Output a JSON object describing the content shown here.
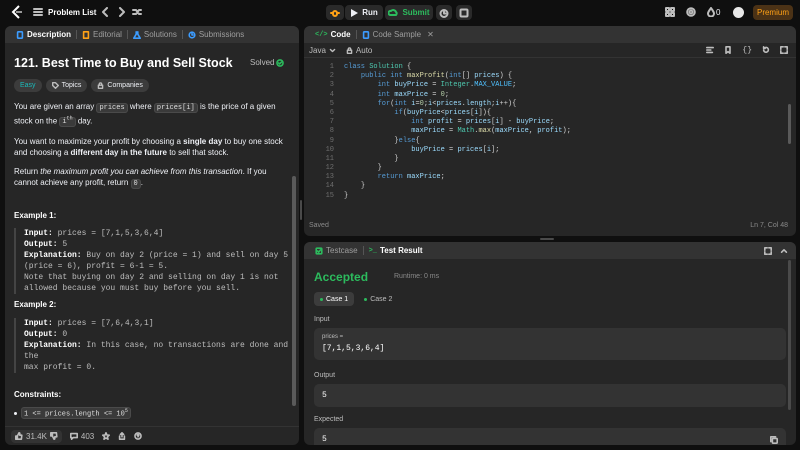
{
  "topbar": {
    "problem_list": "Problem List",
    "run": "Run",
    "submit": "Submit",
    "streak": "0",
    "premium": "Premium"
  },
  "colors": {
    "accent_orange": "#ffa116",
    "green": "#2cbb5d",
    "bg": "#0f0f0f",
    "panel": "#262626"
  },
  "left": {
    "tabs": [
      "Description",
      "Editorial",
      "Solutions",
      "Submissions"
    ],
    "title": "121. Best Time to Buy and Sell Stock",
    "solved": "Solved",
    "tags": [
      "Easy",
      "Topics",
      "Companies"
    ],
    "p1a": "You are given an array",
    "p1_code1": "prices",
    "p1b": "where",
    "p1_code2": "prices[i]",
    "p1c": "is the price of a given stock on the",
    "p1_i": "i",
    "p1_sup": "th",
    "p1d": "day.",
    "p2a": "You want to maximize your profit by choosing a",
    "p2_b1": "single day",
    "p2b": "to buy one stock and choosing a",
    "p2_b2": "different day in the future",
    "p2c": "to sell that stock.",
    "p3a": "Return",
    "p3_em": "the maximum profit you can achieve from this transaction",
    "p3b": ". If you cannot achieve any profit, return",
    "p3_code": "0",
    "p3c": ".",
    "ex1_title": "Example 1:",
    "ex1_input_l": "Input:",
    "ex1_input_v": "prices = [7,1,5,3,6,4]",
    "ex1_output_l": "Output:",
    "ex1_output_v": "5",
    "ex1_expl_l": "Explanation:",
    "ex1_expl_v1": "Buy on day 2 (price = 1) and sell on day 5",
    "ex1_expl_v2": "(price = 6), profit = 6-1 = 5.",
    "ex1_expl_v3": "Note that buying on day 2 and selling on day 1 is not",
    "ex1_expl_v4": "allowed because you must buy before you sell.",
    "ex2_title": "Example 2:",
    "ex2_input_l": "Input:",
    "ex2_input_v": "prices = [7,6,4,3,1]",
    "ex2_output_l": "Output:",
    "ex2_output_v": "0",
    "ex2_expl_l": "Explanation:",
    "ex2_expl_v1": "In this case, no transactions are done and the",
    "ex2_expl_v2": "max profit = 0.",
    "constraints_title": "Constraints:",
    "constraint1": "1 <= prices.length <= 10",
    "constraint1_sup": "5",
    "likes": "31.4K",
    "comments": "403"
  },
  "editor": {
    "tabs": [
      "Code",
      "Code Sample"
    ],
    "language": "Java",
    "auto": "Auto",
    "status": "Saved",
    "cursor": "Ln 7, Col 48",
    "lines": [
      "1",
      "2",
      "3",
      "4",
      "5",
      "6",
      "7",
      "8",
      "9",
      "10",
      "11",
      "12",
      "13",
      "14",
      "15",
      "16"
    ]
  },
  "result": {
    "tabs": [
      "Testcase",
      "Test Result"
    ],
    "status": "Accepted",
    "runtime": "Runtime: 0 ms",
    "cases": [
      "Case 1",
      "Case 2"
    ],
    "input_label": "Input",
    "param_name": "prices =",
    "param_value": "[7,1,5,3,6,4]",
    "output_label": "Output",
    "output_value": "5",
    "expected_label": "Expected",
    "expected_value": "5"
  }
}
